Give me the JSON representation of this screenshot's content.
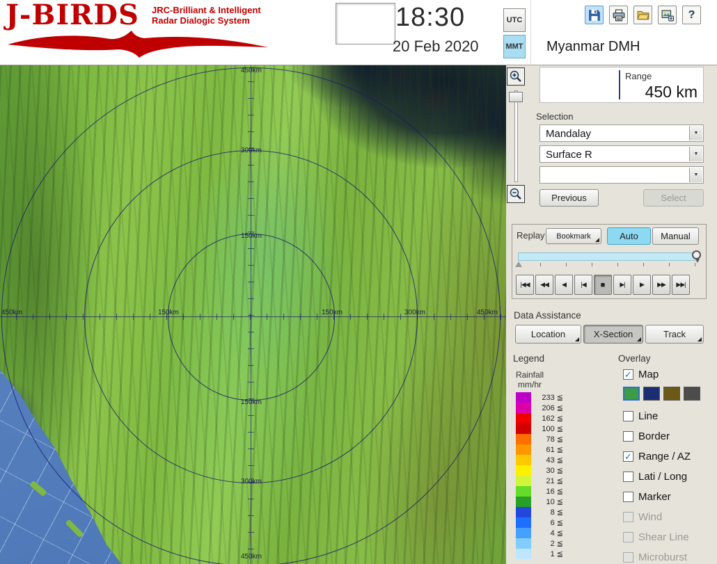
{
  "header": {
    "logo": {
      "title": "J-BIRDS",
      "subtitle1": "JRC-Brilliant & Intelligent",
      "subtitle2": "Radar  Dialogic  System"
    },
    "clock": {
      "time": "18:30",
      "date": "20 Feb 2020"
    },
    "timezone": {
      "utc_label": "UTC",
      "mmt_label": "MMT",
      "selected": "MMT"
    },
    "station_name": "Myanmar DMH",
    "toolbar": {
      "icons": [
        "save",
        "print",
        "open",
        "export",
        "help"
      ],
      "help_glyph": "?"
    }
  },
  "range_panel": {
    "label": "Range",
    "value": "450 km"
  },
  "selection_panel": {
    "label": "Selection",
    "dropdowns": [
      {
        "value": "Mandalay"
      },
      {
        "value": "Surface R"
      },
      {
        "value": ""
      }
    ],
    "previous_label": "Previous",
    "select_label": "Select"
  },
  "replay_panel": {
    "label": "Replay",
    "bookmark_label": "Bookmark",
    "auto_label": "Auto",
    "manual_label": "Manual",
    "active_mode": "Auto",
    "transport": [
      "|◀◀",
      "◀◀",
      "◀",
      "|◀",
      "■",
      "▶|",
      "▶",
      "▶▶",
      "▶▶|"
    ]
  },
  "data_assistance": {
    "label": "Data Assistance",
    "location_label": "Location",
    "xsection_label": "X-Section",
    "track_label": "Track",
    "active": "X-Section"
  },
  "legend": {
    "label": "Legend",
    "unit_line1": "Rainfall",
    "unit_line2": "mm/hr",
    "entries": [
      {
        "value": "233 ≦",
        "color": "#BE00C8"
      },
      {
        "value": "206 ≦",
        "color": "#DC00AA"
      },
      {
        "value": "162 ≦",
        "color": "#F00000"
      },
      {
        "value": "100 ≦",
        "color": "#D20000"
      },
      {
        "value": "78 ≦",
        "color": "#FF6E00"
      },
      {
        "value": "61 ≦",
        "color": "#FF9600"
      },
      {
        "value": "43 ≦",
        "color": "#FFC800"
      },
      {
        "value": "30 ≦",
        "color": "#FFF000"
      },
      {
        "value": "21 ≦",
        "color": "#D2F53C"
      },
      {
        "value": "16 ≦",
        "color": "#64DC28"
      },
      {
        "value": "10 ≦",
        "color": "#28A028"
      },
      {
        "value": "8 ≦",
        "color": "#2346DC"
      },
      {
        "value": "6 ≦",
        "color": "#1E6EFF"
      },
      {
        "value": "4 ≦",
        "color": "#46A0FF"
      },
      {
        "value": "2 ≦",
        "color": "#82CDFF"
      },
      {
        "value": "1 ≦",
        "color": "#BEE6FF"
      }
    ]
  },
  "overlay": {
    "label": "Overlay",
    "items": [
      {
        "label": "Map",
        "checked": true,
        "disabled": false,
        "check": "✓"
      },
      {
        "label": "Line",
        "checked": false,
        "disabled": false,
        "check": ""
      },
      {
        "label": "Border",
        "checked": false,
        "disabled": false,
        "check": ""
      },
      {
        "label": "Range / AZ",
        "checked": true,
        "disabled": false,
        "check": "✓"
      },
      {
        "label": "Lati / Long",
        "checked": false,
        "disabled": false,
        "check": ""
      },
      {
        "label": "Marker",
        "checked": false,
        "disabled": false,
        "check": ""
      },
      {
        "label": "Wind",
        "checked": false,
        "disabled": true,
        "check": ""
      },
      {
        "label": "Shear Line",
        "checked": false,
        "disabled": true,
        "check": ""
      },
      {
        "label": "Microburst",
        "checked": false,
        "disabled": true,
        "check": ""
      }
    ],
    "map_palette": [
      "#3C9B46",
      "#1C2E73",
      "#6B5A16",
      "#4C4C4C"
    ],
    "selected_palette_index": 0
  },
  "map": {
    "v_labels": [
      "450km",
      "300km",
      "150km",
      "150km",
      "300km",
      "450km"
    ],
    "h_labels": [
      "450km",
      "150km",
      "150km",
      "300km",
      "450km"
    ]
  }
}
